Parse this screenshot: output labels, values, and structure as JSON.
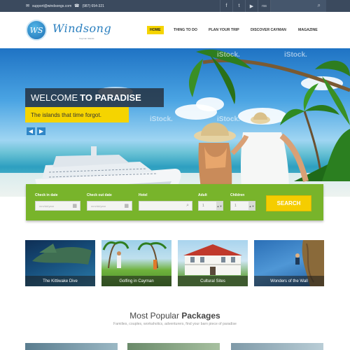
{
  "topbar": {
    "email": "support@windsongs.com",
    "phone": "(987) 654-321",
    "social": [
      "f",
      "t",
      "▶",
      "rss"
    ]
  },
  "header": {
    "logo_monogram": "WS",
    "logo_text": "Windsong",
    "logo_sub": "Cayman Islands",
    "nav": [
      "HOME",
      "THING TO DO",
      "PLAN YOUR TRIP",
      "DISCOVER CAYMAN",
      "MAGAZINE"
    ]
  },
  "hero": {
    "welcome_light": "WELCOME ",
    "welcome_bold": "TO PARADISE",
    "tagline": "The islands that time forgot.",
    "watermark": "iStock."
  },
  "search": {
    "checkin_label": "Check in date",
    "checkin_placeholder": "mm/dd/year",
    "checkout_label": "Check out date",
    "checkout_placeholder": "mm/dd/year",
    "hotel_label": "Hotel",
    "adult_label": "Adult",
    "adult_value": "1",
    "children_label": "Children",
    "children_value": "1",
    "button": "SEARCH"
  },
  "tiles": [
    "The Kittiwake Dive",
    "Golfing in Cayman",
    "Cultural Sites",
    "Wonders of the Wall"
  ],
  "packages": {
    "title_light": "Most Popular ",
    "title_bold": "Packages",
    "subtitle": "Families, couples, workaholics, adventurers, find your barn piece of paradise"
  },
  "colors": {
    "topbar": "#3b4a5e",
    "accent_yellow": "#f5d400",
    "panel_green": "#78b42b",
    "arrow_blue": "#2f86c7"
  }
}
